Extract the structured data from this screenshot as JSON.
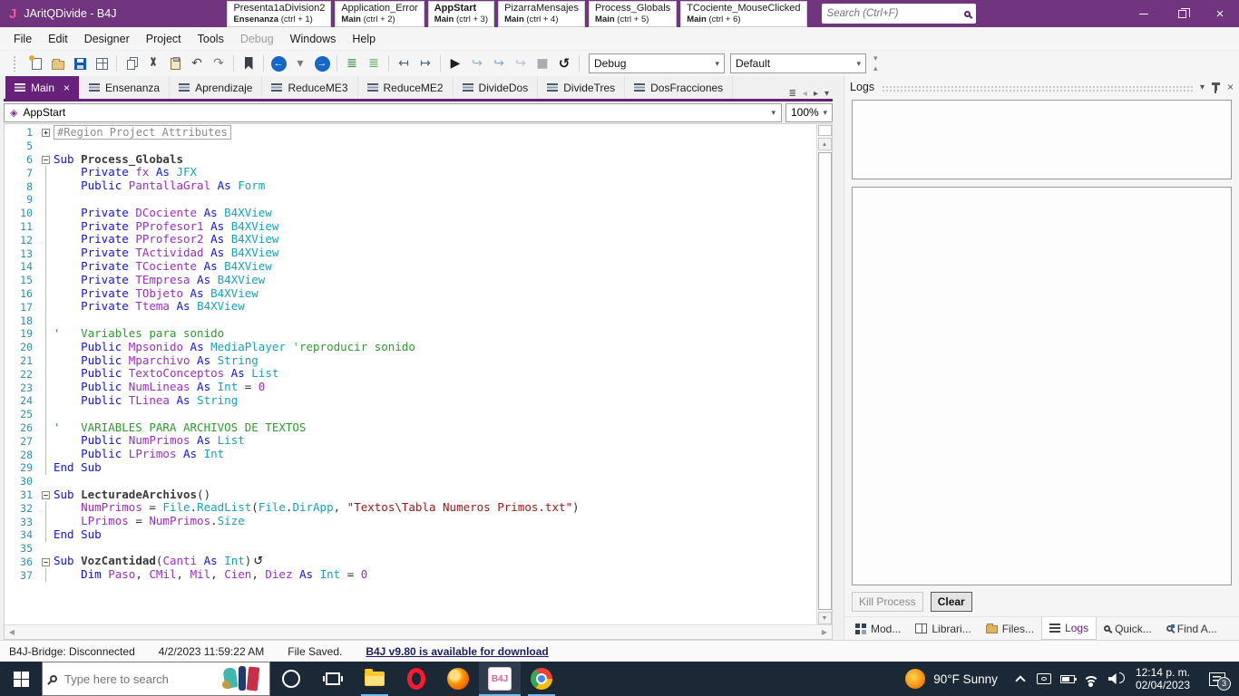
{
  "window": {
    "title": "JAritQDivide - B4J",
    "logo": "J",
    "search_placeholder": "Search (Ctrl+F)"
  },
  "bookmark_tabs": [
    {
      "title": "Presenta1aDivision2",
      "module": "Ensenanza",
      "shortcut": "(ctrl + 1)",
      "active": false
    },
    {
      "title": "Application_Error",
      "module": "Main",
      "shortcut": "(ctrl + 2)",
      "active": false
    },
    {
      "title": "AppStart",
      "module": "Main",
      "shortcut": "(ctrl + 3)",
      "active": true
    },
    {
      "title": "PizarraMensajes",
      "module": "Main",
      "shortcut": "(ctrl + 4)",
      "active": false
    },
    {
      "title": "Process_Globals",
      "module": "Main",
      "shortcut": "(ctrl + 5)",
      "active": false
    },
    {
      "title": "TCociente_MouseClicked",
      "module": "Main",
      "shortcut": "(ctrl + 6)",
      "active": false
    }
  ],
  "menu": [
    {
      "label": "File",
      "enabled": true
    },
    {
      "label": "Edit",
      "enabled": true
    },
    {
      "label": "Designer",
      "enabled": true
    },
    {
      "label": "Project",
      "enabled": true
    },
    {
      "label": "Tools",
      "enabled": true
    },
    {
      "label": "Debug",
      "enabled": false
    },
    {
      "label": "Windows",
      "enabled": true
    },
    {
      "label": "Help",
      "enabled": true
    }
  ],
  "toolbar": {
    "icons": [
      "grip",
      "new-file",
      "open-project",
      "save",
      "save-all",
      "sep",
      "copy",
      "cut",
      "paste",
      "undo",
      "redo",
      "sep",
      "bookmark",
      "sep",
      "nav-back",
      "nav-caret",
      "nav-forward",
      "sep",
      "format-code",
      "comment-code",
      "sep",
      "outdent",
      "indent",
      "sep",
      "run",
      "step-over",
      "step-into",
      "step-out",
      "stop",
      "restart",
      "sep"
    ],
    "debug_mode": "Debug",
    "build_config": "Default"
  },
  "editor_tabs": [
    {
      "label": "Main",
      "active": true
    },
    {
      "label": "Ensenanza",
      "active": false
    },
    {
      "label": "Aprendizaje",
      "active": false
    },
    {
      "label": "ReduceME3",
      "active": false
    },
    {
      "label": "ReduceME2",
      "active": false
    },
    {
      "label": "DivideDos",
      "active": false
    },
    {
      "label": "DivideTres",
      "active": false
    },
    {
      "label": "DosFracciones",
      "active": false
    }
  ],
  "code": {
    "selector": "AppStart",
    "zoom_level": "100%",
    "lines": [
      {
        "n": "1",
        "f": "+",
        "t": [
          [
            "rg",
            "#Region Project Attributes"
          ]
        ]
      },
      {
        "n": "5",
        "f": "",
        "t": []
      },
      {
        "n": "6",
        "f": "-",
        "t": [
          [
            "kw",
            "Sub "
          ],
          [
            "sub",
            "Process_Globals"
          ]
        ]
      },
      {
        "n": "7",
        "f": "g",
        "t": [
          [
            "kw",
            "    Private "
          ],
          [
            "id",
            "fx"
          ],
          [
            "kw",
            " As "
          ],
          [
            "ty",
            "JFX"
          ]
        ]
      },
      {
        "n": "8",
        "f": "g",
        "t": [
          [
            "kw",
            "    Public "
          ],
          [
            "id",
            "PantallaGral"
          ],
          [
            "kw",
            " As "
          ],
          [
            "ty",
            "Form"
          ]
        ]
      },
      {
        "n": "9",
        "f": "g",
        "t": []
      },
      {
        "n": "10",
        "f": "g",
        "t": [
          [
            "kw",
            "    Private "
          ],
          [
            "id",
            "DCociente"
          ],
          [
            "kw",
            " As "
          ],
          [
            "ty",
            "B4XView"
          ]
        ]
      },
      {
        "n": "11",
        "f": "g",
        "t": [
          [
            "kw",
            "    Private "
          ],
          [
            "id",
            "PProfesor1"
          ],
          [
            "kw",
            " As "
          ],
          [
            "ty",
            "B4XView"
          ]
        ]
      },
      {
        "n": "12",
        "f": "g",
        "t": [
          [
            "kw",
            "    Private "
          ],
          [
            "id",
            "PProfesor2"
          ],
          [
            "kw",
            " As "
          ],
          [
            "ty",
            "B4XView"
          ]
        ]
      },
      {
        "n": "13",
        "f": "g",
        "t": [
          [
            "kw",
            "    Private "
          ],
          [
            "id",
            "TActividad"
          ],
          [
            "kw",
            " As "
          ],
          [
            "ty",
            "B4XView"
          ]
        ]
      },
      {
        "n": "14",
        "f": "g",
        "t": [
          [
            "kw",
            "    Private "
          ],
          [
            "id",
            "TCociente"
          ],
          [
            "kw",
            " As "
          ],
          [
            "ty",
            "B4XView"
          ]
        ]
      },
      {
        "n": "15",
        "f": "g",
        "t": [
          [
            "kw",
            "    Private "
          ],
          [
            "id",
            "TEmpresa"
          ],
          [
            "kw",
            " As "
          ],
          [
            "ty",
            "B4XView"
          ]
        ]
      },
      {
        "n": "16",
        "f": "g",
        "t": [
          [
            "kw",
            "    Private "
          ],
          [
            "id",
            "TObjeto"
          ],
          [
            "kw",
            " As "
          ],
          [
            "ty",
            "B4XView"
          ]
        ]
      },
      {
        "n": "17",
        "f": "g",
        "t": [
          [
            "kw",
            "    Private "
          ],
          [
            "id",
            "Ttema"
          ],
          [
            "kw",
            " As "
          ],
          [
            "ty",
            "B4XView"
          ]
        ]
      },
      {
        "n": "18",
        "f": "g",
        "t": []
      },
      {
        "n": "19",
        "f": "g",
        "t": [
          [
            "cm",
            "'   Variables para sonido"
          ]
        ]
      },
      {
        "n": "20",
        "f": "g",
        "t": [
          [
            "kw",
            "    Public "
          ],
          [
            "id",
            "Mpsonido"
          ],
          [
            "kw",
            " As "
          ],
          [
            "ty",
            "MediaPlayer"
          ],
          [
            "cm",
            " 'reproducir sonido"
          ]
        ]
      },
      {
        "n": "21",
        "f": "g",
        "t": [
          [
            "kw",
            "    Public "
          ],
          [
            "id",
            "Mparchivo"
          ],
          [
            "kw",
            " As "
          ],
          [
            "ty",
            "String"
          ]
        ]
      },
      {
        "n": "22",
        "f": "g",
        "t": [
          [
            "kw",
            "    Public "
          ],
          [
            "id",
            "TextoConceptos"
          ],
          [
            "kw",
            " As "
          ],
          [
            "ty",
            "List"
          ]
        ]
      },
      {
        "n": "23",
        "f": "g",
        "t": [
          [
            "kw",
            "    Public "
          ],
          [
            "id",
            "NumLineas"
          ],
          [
            "kw",
            " As "
          ],
          [
            "ty",
            "Int"
          ],
          [
            "pl",
            " = "
          ],
          [
            "nu",
            "0"
          ]
        ]
      },
      {
        "n": "24",
        "f": "g",
        "t": [
          [
            "kw",
            "    Public "
          ],
          [
            "id",
            "TLinea"
          ],
          [
            "kw",
            " As "
          ],
          [
            "ty",
            "String"
          ]
        ]
      },
      {
        "n": "25",
        "f": "g",
        "t": []
      },
      {
        "n": "26",
        "f": "g",
        "t": [
          [
            "cm",
            "'   VARIABLES PARA ARCHIVOS DE TEXTOS"
          ]
        ]
      },
      {
        "n": "27",
        "f": "g",
        "t": [
          [
            "kw",
            "    Public "
          ],
          [
            "id",
            "NumPrimos"
          ],
          [
            "kw",
            " As "
          ],
          [
            "ty",
            "List"
          ]
        ]
      },
      {
        "n": "28",
        "f": "g",
        "t": [
          [
            "kw",
            "    Public "
          ],
          [
            "id",
            "LPrimos"
          ],
          [
            "kw",
            " As "
          ],
          [
            "ty",
            "Int"
          ]
        ]
      },
      {
        "n": "29",
        "f": "g",
        "t": [
          [
            "kw",
            "End Sub"
          ]
        ]
      },
      {
        "n": "30",
        "f": "",
        "t": []
      },
      {
        "n": "31",
        "f": "-",
        "t": [
          [
            "kw",
            "Sub "
          ],
          [
            "sub",
            "LecturadeArchivos"
          ],
          [
            "pl",
            "()"
          ]
        ]
      },
      {
        "n": "32",
        "f": "g",
        "t": [
          [
            "pl",
            "    "
          ],
          [
            "id",
            "NumPrimos"
          ],
          [
            "pl",
            " = "
          ],
          [
            "ty",
            "File"
          ],
          [
            "pl",
            "."
          ],
          [
            "ty",
            "ReadList"
          ],
          [
            "pl",
            "("
          ],
          [
            "ty",
            "File"
          ],
          [
            "pl",
            "."
          ],
          [
            "ty",
            "DirApp"
          ],
          [
            "pl",
            ", "
          ],
          [
            "st",
            "\"Textos\\Tabla Numeros Primos.txt\""
          ],
          [
            "pl",
            ")"
          ]
        ]
      },
      {
        "n": "33",
        "f": "g",
        "t": [
          [
            "pl",
            "    "
          ],
          [
            "id",
            "LPrimos"
          ],
          [
            "pl",
            " = "
          ],
          [
            "id",
            "NumPrimos"
          ],
          [
            "pl",
            "."
          ],
          [
            "ty",
            "Size"
          ]
        ]
      },
      {
        "n": "34",
        "f": "g",
        "t": [
          [
            "kw",
            "End Sub"
          ]
        ]
      },
      {
        "n": "35",
        "f": "",
        "t": []
      },
      {
        "n": "36",
        "f": "-",
        "t": [
          [
            "kw",
            "Sub "
          ],
          [
            "sub",
            "VozCantidad"
          ],
          [
            "pl",
            "("
          ],
          [
            "id",
            "Canti"
          ],
          [
            "kw",
            " As "
          ],
          [
            "ty",
            "Int"
          ],
          [
            "pl",
            ")"
          ],
          [
            "ic",
            "↺"
          ]
        ]
      },
      {
        "n": "37",
        "f": "g",
        "t": [
          [
            "pl",
            "    "
          ],
          [
            "kw",
            "Dim "
          ],
          [
            "id",
            "Paso"
          ],
          [
            "pl",
            ", "
          ],
          [
            "id",
            "CMil"
          ],
          [
            "pl",
            ", "
          ],
          [
            "id",
            "Mil"
          ],
          [
            "pl",
            ", "
          ],
          [
            "id",
            "Cien"
          ],
          [
            "pl",
            ", "
          ],
          [
            "id",
            "Diez"
          ],
          [
            "kw",
            " As "
          ],
          [
            "ty",
            "Int"
          ],
          [
            "pl",
            " = "
          ],
          [
            "nu",
            "0"
          ]
        ]
      }
    ]
  },
  "logs_panel": {
    "title": "Logs",
    "kill_button": "Kill Process",
    "clear_button": "Clear",
    "tabs": [
      {
        "label": "Mod...",
        "icon": "modules",
        "active": false
      },
      {
        "label": "Librari...",
        "icon": "libraries",
        "active": false
      },
      {
        "label": "Files...",
        "icon": "files",
        "active": false
      },
      {
        "label": "Logs",
        "icon": "logs",
        "active": true
      },
      {
        "label": "Quick...",
        "icon": "quick-search",
        "active": false
      },
      {
        "label": "Find A...",
        "icon": "find-all",
        "active": false
      }
    ]
  },
  "status_bar": {
    "bridge": "B4J-Bridge: Disconnected",
    "timestamp": "4/2/2023 11:59:22 AM",
    "file_status": "File Saved.",
    "update_link": "B4J v9.80 is available for download"
  },
  "taskbar": {
    "search_placeholder": "Type here to search",
    "weather": "90°F Sunny",
    "time": "12:14 p. m.",
    "date": "02/04/2023",
    "notification_count": "3"
  },
  "colors": {
    "titlebar": "#71357f",
    "accent_purple": "#68217A",
    "keyword_blue": "#1414DC",
    "type_teal": "#18A2B8",
    "identifier_purple": "#9B2FBE",
    "comment_green": "#2F9A2F",
    "string_red": "#A31515",
    "line_number": "#2B91AF",
    "taskbar_bg": "#1b2936",
    "running_indicator": "#76b9ed"
  }
}
